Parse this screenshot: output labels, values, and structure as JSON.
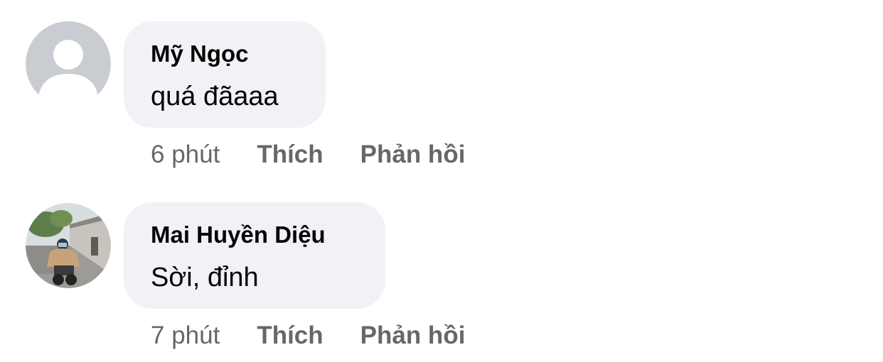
{
  "comments": [
    {
      "author": "Mỹ Ngọc",
      "text": "quá đãaaa",
      "time": "6 phút",
      "like_label": "Thích",
      "reply_label": "Phản hồi",
      "avatar_icon": "default-user-icon"
    },
    {
      "author": "Mai Huyền Diệu",
      "text": "Sời, đỉnh",
      "time": "7 phút",
      "like_label": "Thích",
      "reply_label": "Phản hồi",
      "avatar_icon": "profile-photo"
    }
  ],
  "colors": {
    "bubble_bg": "#f0f2f5",
    "secondary_text": "#65676b",
    "primary_text": "#050505",
    "default_avatar_bg": "#bcc0c4"
  }
}
